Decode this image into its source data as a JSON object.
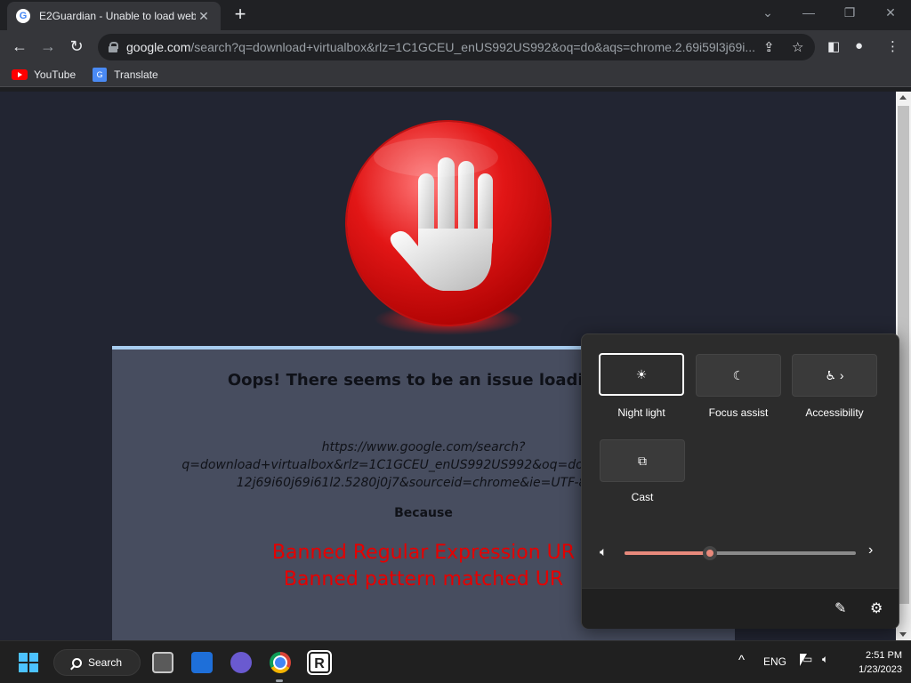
{
  "browser": {
    "tab_title": "E2Guardian - Unable to load web",
    "url_domain": "google.com",
    "url_path": "/search?q=download+virtualbox&rlz=1C1GCEU_enUS992US992&oq=do&aqs=chrome.2.69i59l3j69i...",
    "bookmarks": [
      {
        "label": "YouTube",
        "icon": "youtube-icon"
      },
      {
        "label": "Translate",
        "icon": "translate-icon"
      }
    ]
  },
  "page": {
    "heading": "Oops! There seems to be an issue loading t",
    "url_line1": "https://www.google.com/search?",
    "url_line2": "q=download+virtualbox&rlz=1C1GCEU_enUS992US992&oq=do&aqs=chrom",
    "url_line3": "12j69i60j69i61l2.5280j0j7&sourceid=chrome&ie=UTF-8&sa",
    "because": "Because",
    "reason1": "Banned Regular Expression UR",
    "reason2": "Banned pattern matched UR",
    "accent_color": "#e60000"
  },
  "quick_settings": {
    "tiles": [
      {
        "label": "Night light",
        "icon": "night-light-icon",
        "selected": true
      },
      {
        "label": "Focus assist",
        "icon": "moon-icon",
        "selected": false
      },
      {
        "label": "Accessibility",
        "icon": "accessibility-icon",
        "selected": false
      },
      {
        "label": "Cast",
        "icon": "cast-icon",
        "selected": false
      }
    ],
    "volume_level": 0.37
  },
  "taskbar": {
    "search_label": "Search",
    "language": "ENG",
    "time": "2:51 PM",
    "date": "1/23/2023"
  }
}
